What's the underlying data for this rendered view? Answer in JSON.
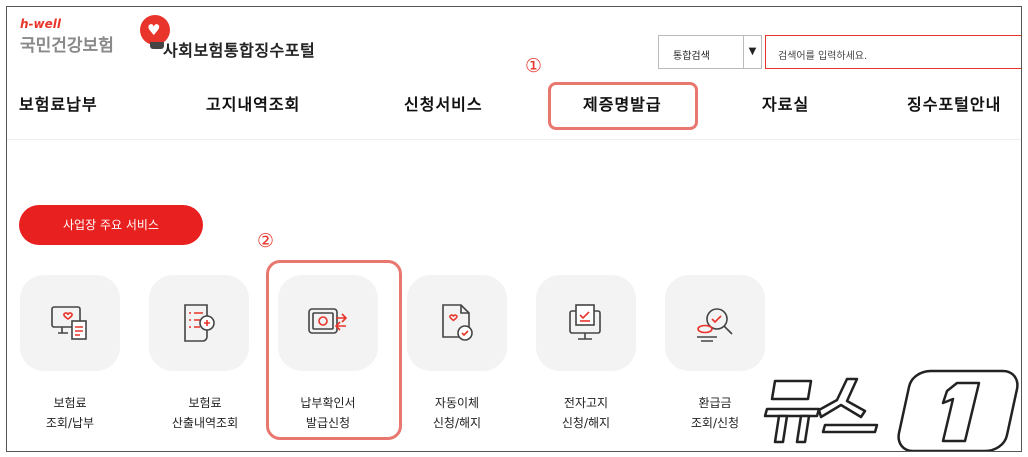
{
  "header": {
    "logo_small": "h-well",
    "logo_main": "국민건강보험",
    "portal_title": "사회보험통합징수포털"
  },
  "search": {
    "scope": "통합검색",
    "placeholder": "검색어를 입력하세요."
  },
  "annotations": {
    "step1": "①",
    "step2": "②"
  },
  "nav": {
    "items": [
      {
        "label": "보험료납부"
      },
      {
        "label": "고지내역조회"
      },
      {
        "label": "신청서비스"
      },
      {
        "label": "제증명발급"
      },
      {
        "label": "자료실"
      },
      {
        "label": "징수포털안내"
      }
    ]
  },
  "services": {
    "pill_label": "사업장 주요 서비스",
    "items": [
      {
        "line1": "보험료",
        "line2": "조회/납부",
        "icon": "monitor-bill-icon"
      },
      {
        "line1": "보험료",
        "line2": "산출내역조회",
        "icon": "calculation-list-icon"
      },
      {
        "line1": "납부확인서",
        "line2": "발급신청",
        "icon": "certificate-issue-icon"
      },
      {
        "line1": "자동이체",
        "line2": "신청/해지",
        "icon": "auto-transfer-icon"
      },
      {
        "line1": "전자고지",
        "line2": "신청/해지",
        "icon": "e-notice-icon"
      },
      {
        "line1": "환급금",
        "line2": "조회/신청",
        "icon": "refund-search-icon"
      }
    ]
  },
  "watermark": {
    "text": "뉴스1"
  },
  "colors": {
    "accent": "#e8342a",
    "highlight": "#e8776f",
    "tile": "#f3f3f3"
  }
}
